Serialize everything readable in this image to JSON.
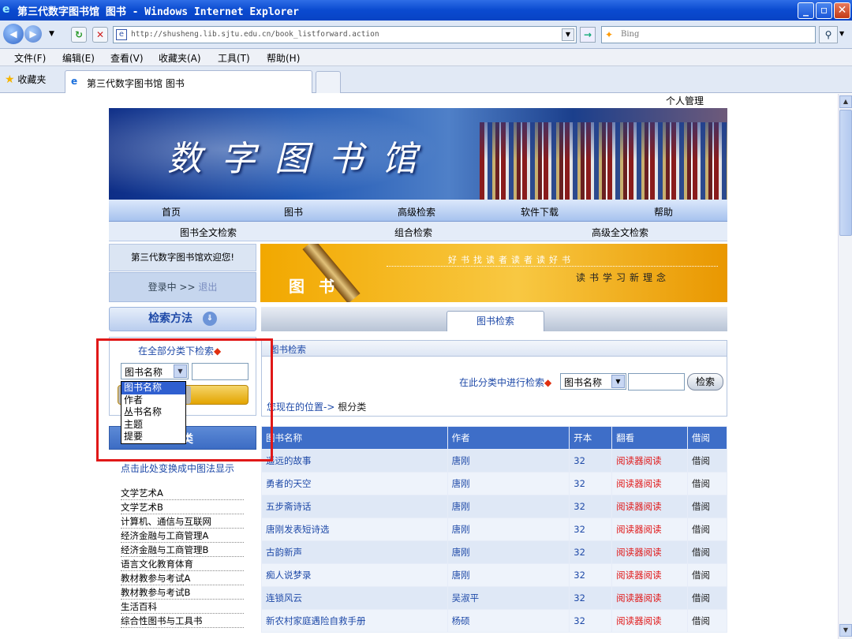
{
  "window": {
    "title": "第三代数字图书馆 图书 - Windows Internet Explorer"
  },
  "address": {
    "url": "http://shusheng.lib.sjtu.edu.cn/book_listforward.action",
    "search_placeholder": "Bing"
  },
  "menu": [
    "文件(F)",
    "编辑(E)",
    "查看(V)",
    "收藏夹(A)",
    "工具(T)",
    "帮助(H)"
  ],
  "favorites_label": "收藏夹",
  "tab_label": "第三代数字图书馆 图书",
  "personal_link": "个人管理",
  "banner_title": "数字图书馆",
  "main_nav": [
    "首页",
    "图书",
    "高级检索",
    "软件下载",
    "帮助"
  ],
  "sub_nav": [
    "图书全文检索",
    "组合检索",
    "高级全文检索"
  ],
  "welcome": "第三代数字图书馆欢迎您!",
  "login": {
    "status": "登录中 >>",
    "logout": "退出"
  },
  "book_banner": {
    "label": "图书",
    "slogan1": "好书找读者读者读好书",
    "slogan2": "读书学习新理念"
  },
  "method_label": "检索方法",
  "search_tab": "图书检索",
  "left_search": {
    "caption": "在全部分类下检索",
    "selected": "图书名称",
    "options": [
      "图书名称",
      "作者",
      "丛书名称",
      "主题",
      "提要"
    ]
  },
  "category": {
    "title": "分类",
    "switch_link": "点击此处变换成中图法显示",
    "items": [
      "文学艺术A",
      "文学艺术B",
      "计算机、通信与互联网",
      "经济金融与工商管理A",
      "经济金融与工商管理B",
      "语言文化教育体育",
      "教材教参与考试A",
      "教材教参与考试B",
      "生活百科",
      "综合性图书与工具书"
    ]
  },
  "right_search": {
    "header": "图书检索",
    "class_label": "在此分类中进行检索",
    "selected": "图书名称",
    "button": "检索",
    "location_label": "您现在的位置->",
    "location_value": "根分类"
  },
  "table": {
    "headers": [
      "图书名称",
      "作者",
      "开本",
      "翻看",
      "借阅"
    ],
    "rows": [
      [
        "遥远的故事",
        "唐刚",
        "32",
        "阅读器阅读",
        "借阅"
      ],
      [
        "勇者的天空",
        "唐刚",
        "32",
        "阅读器阅读",
        "借阅"
      ],
      [
        "五步斋诗话",
        "唐刚",
        "32",
        "阅读器阅读",
        "借阅"
      ],
      [
        "唐刚发表短诗选",
        "唐刚",
        "32",
        "阅读器阅读",
        "借阅"
      ],
      [
        "古韵新声",
        "唐刚",
        "32",
        "阅读器阅读",
        "借阅"
      ],
      [
        "痴人说梦录",
        "唐刚",
        "32",
        "阅读器阅读",
        "借阅"
      ],
      [
        "连锁风云",
        "吴淑平",
        "32",
        "阅读器阅读",
        "借阅"
      ],
      [
        "新农村家庭遇险自救手册",
        "杨硕",
        "32",
        "阅读器阅读",
        "借阅"
      ]
    ]
  }
}
